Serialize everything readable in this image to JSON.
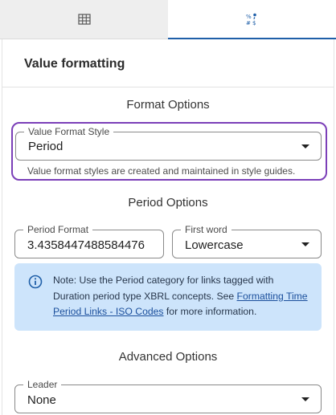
{
  "tabs": [
    {
      "icon": "table-grid-icon",
      "active": false
    },
    {
      "icon": "number-format-icon",
      "active": true
    }
  ],
  "panel": {
    "title": "Value formatting"
  },
  "format_options": {
    "heading": "Format Options",
    "style_field": {
      "label": "Value Format Style",
      "value": "Period"
    },
    "helper": "Value format styles are created and maintained in style guides."
  },
  "period_options": {
    "heading": "Period Options",
    "period_format": {
      "label": "Period Format",
      "value": "3.4358447488584476"
    },
    "first_word": {
      "label": "First word",
      "value": "Lowercase"
    }
  },
  "info": {
    "text_before": "Note: Use the Period category for links tagged with Duration period type XBRL concepts. See ",
    "link": "Formatting Time Period Links - ISO Codes",
    "text_after": " for more information."
  },
  "advanced_options": {
    "heading": "Advanced Options",
    "leader": {
      "label": "Leader",
      "value": "None"
    }
  },
  "colors": {
    "focus": "#7b3fb8",
    "info_bg": "#cde4fb",
    "active_tab": "#1f5fa8",
    "link": "#1b4f9c"
  }
}
